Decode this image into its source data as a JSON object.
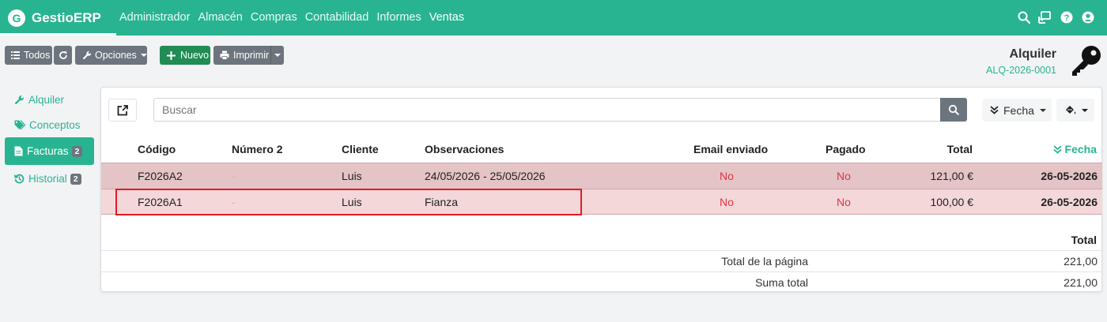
{
  "navbar": {
    "brand_letter": "G",
    "brand_name": "GestioERP",
    "menu": [
      "Administrador",
      "Almacén",
      "Compras",
      "Contabilidad",
      "Informes",
      "Ventas"
    ],
    "icons": [
      "search-icon",
      "remote-desktop-icon",
      "help-icon",
      "user-icon"
    ]
  },
  "toolbar": {
    "todos_label": "Todos",
    "opciones_label": "Opciones",
    "nuevo_label": "Nuevo",
    "imprimir_label": "Imprimir"
  },
  "document": {
    "title": "Alquiler",
    "code": "ALQ-2026-0001",
    "icon": "key-icon"
  },
  "sidebar": {
    "items": [
      {
        "label": "Alquiler",
        "icon": "wrench-icon",
        "count": ""
      },
      {
        "label": "Conceptos",
        "icon": "tags-icon",
        "count": ""
      },
      {
        "label": "Facturas",
        "icon": "file-invoice-icon",
        "count": "2"
      },
      {
        "label": "Historial",
        "icon": "history-icon",
        "count": "2"
      }
    ]
  },
  "list": {
    "search_placeholder": "Buscar",
    "sort_label": "Fecha",
    "columns": {
      "codigo": "Código",
      "numero2": "Número 2",
      "cliente": "Cliente",
      "observaciones": "Observaciones",
      "email": "Email enviado",
      "pagado": "Pagado",
      "total": "Total",
      "fecha": "Fecha"
    },
    "rows": [
      {
        "codigo": "F2026A2",
        "numero2": "-",
        "cliente": "Luis",
        "observaciones": "24/05/2026 - 25/05/2026",
        "email": "No",
        "pagado": "No",
        "total": "121,00 €",
        "fecha": "26-05-2026"
      },
      {
        "codigo": "F2026A1",
        "numero2": "-",
        "cliente": "Luis",
        "observaciones": "Fianza",
        "email": "No",
        "pagado": "No",
        "total": "100,00 €",
        "fecha": "26-05-2026"
      }
    ],
    "totals": {
      "header": "Total",
      "page_label": "Total de la página",
      "page_value": "221,00",
      "sum_label": "Suma total",
      "sum_value": "221,00"
    }
  },
  "colors": {
    "brand": "#28b491",
    "row_unpaid_dark": "#e4c4c6",
    "row_unpaid_light": "#f3d7d9",
    "negative": "#dc3545",
    "highlight": "#dc1e25"
  }
}
